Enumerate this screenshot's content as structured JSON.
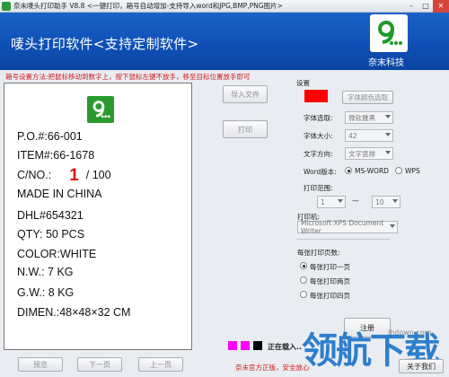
{
  "window": {
    "title": "奈末唛头打印助手 V8.8  <一键打印，箱号自动增加-支持导入word和JPG,BMP,PNG图片>",
    "controls": {
      "minimize": "–",
      "maximize": "□",
      "close": "✕"
    }
  },
  "banner": {
    "title": "唛头打印软件<支持定制软件>",
    "brand_logo": "9...",
    "brand_name": "奈末科技"
  },
  "hint": "箱号设置方法:把鼠标移动到数字上，按下鼠标左键不放手，移至目标位置放手即可",
  "label": {
    "logo": "9...",
    "po": "P.O.#:66-001",
    "item": "ITEM#:66-1678",
    "cno_prefix": "C/NO.:",
    "cno_number": "1",
    "cno_total": "/ 100",
    "made_in": "MADE   IN CHINA",
    "dhl": "DHL#654321",
    "qty": "QTY:      50        PCS",
    "color": "COLOR:WHITE",
    "nw": "N.W.:      7             KG",
    "gw": "G.W.:      8             KG",
    "dimen": "DIMEN.:48×48×32 CM"
  },
  "actions": {
    "import_file": "导入文件",
    "print": "打印"
  },
  "settings": {
    "group_title": "设置",
    "swatch_color": "#ff0000",
    "font_color_button": "字体颜色选取",
    "font_select_label": "字体选取:",
    "font_select_value": "微软雅黑",
    "font_size_label": "字体大小:",
    "font_size_value": "42",
    "text_direction_label": "文字方向:",
    "text_direction_value": "文字竖排",
    "word_version_label": "Word版本:",
    "ms_word_label": "MS-WORD",
    "wps_label": "WPS",
    "print_range_label": "打印范围:",
    "range_from": "1",
    "range_dash": "—",
    "range_to": "10",
    "printer_label": "打印机:",
    "printer_value": "Microsoft XPS Document Writer",
    "pages_per_sheet_label": "每张打印页数:",
    "one_page": "每张打印一页",
    "two_pages": "每张打印两页",
    "four_pages": "每张打印四页",
    "register_button": "注册"
  },
  "nav": {
    "preview": "预览",
    "next_page": "下一页",
    "prev_page": "上一页"
  },
  "status": {
    "loading_text": "正在载入..",
    "loading_colors": [
      "#ff00ff",
      "#ff00ff",
      "#000000"
    ]
  },
  "footer": {
    "note": "奈末官方正版，安全放心",
    "about_button": "关于我们"
  },
  "watermark": {
    "text": "领航下载",
    "url": "lhdown.com"
  }
}
